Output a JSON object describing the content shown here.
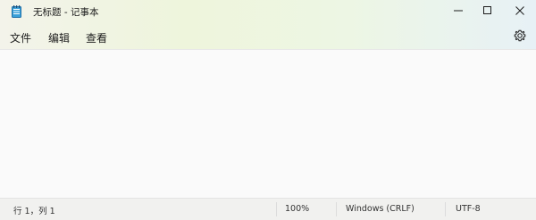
{
  "window": {
    "title": "无标题 - 记事本",
    "app_icon": "notepad-icon"
  },
  "controls": {
    "minimize_icon": "minimize-icon",
    "maximize_icon": "maximize-icon",
    "close_icon": "close-icon"
  },
  "menu": {
    "items": [
      {
        "label": "文件"
      },
      {
        "label": "编辑"
      },
      {
        "label": "查看"
      }
    ],
    "settings_icon": "gear-icon"
  },
  "editor": {
    "content": ""
  },
  "status": {
    "position": "行 1，列 1",
    "zoom": "100%",
    "line_ending": "Windows (CRLF)",
    "encoding": "UTF-8"
  }
}
